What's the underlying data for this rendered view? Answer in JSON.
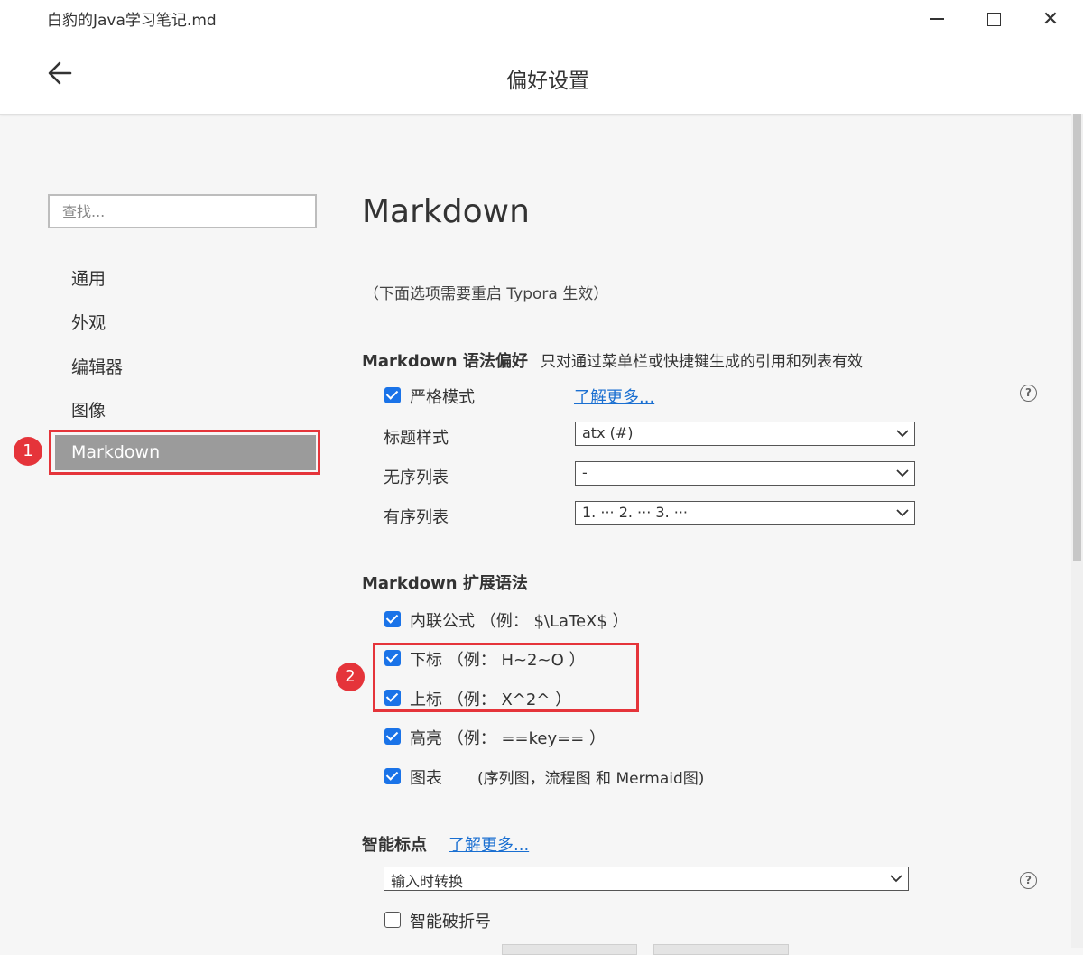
{
  "window": {
    "title": "白豹的Java学习笔记.md",
    "close_glyph": "✕"
  },
  "header": {
    "title": "偏好设置"
  },
  "sidebar": {
    "search_placeholder": "查找...",
    "items": [
      {
        "label": "通用"
      },
      {
        "label": "外观"
      },
      {
        "label": "编辑器"
      },
      {
        "label": "图像"
      },
      {
        "label": "Markdown",
        "active": true
      }
    ]
  },
  "annotations": {
    "badge1": "1",
    "badge2": "2",
    "highlight_color": "#e5343a"
  },
  "main": {
    "heading": "Markdown",
    "restart_note": "（下面选项需要重启 Typora 生效）",
    "syntax": {
      "title": "Markdown 语法偏好",
      "description": "只对通过菜单栏或快捷键生成的引用和列表有效",
      "strict_mode": {
        "label": "严格模式",
        "checked": true
      },
      "learn_more": "了解更多...",
      "heading_style": {
        "label": "标题样式",
        "value": "atx (#)"
      },
      "unordered_list": {
        "label": "无序列表",
        "value": "-"
      },
      "ordered_list": {
        "label": "有序列表",
        "value": "1. ··· 2. ··· 3. ···"
      }
    },
    "extensions": {
      "title": "Markdown 扩展语法",
      "items": [
        {
          "label": "内联公式 （例： $\\LaTeX$ ）",
          "checked": true
        },
        {
          "label": "下标 （例： H~2~O ）",
          "checked": true
        },
        {
          "label": "上标 （例： X^2^ ）",
          "checked": true
        },
        {
          "label": "高亮 （例： ==key== ）",
          "checked": true
        },
        {
          "label": "图表 ",
          "checked": true
        }
      ],
      "diagram_note": "(序列图，流程图 和 Mermaid图)"
    },
    "smart_punct": {
      "title": "智能标点",
      "learn_more": "了解更多...",
      "mode": "输入时转换",
      "smart_dash": {
        "label": "智能破折号",
        "checked": false
      }
    }
  },
  "colors": {
    "accent": "#1a73e8",
    "link": "#1a6fd1",
    "active_nav_bg": "#9b9b9b"
  }
}
